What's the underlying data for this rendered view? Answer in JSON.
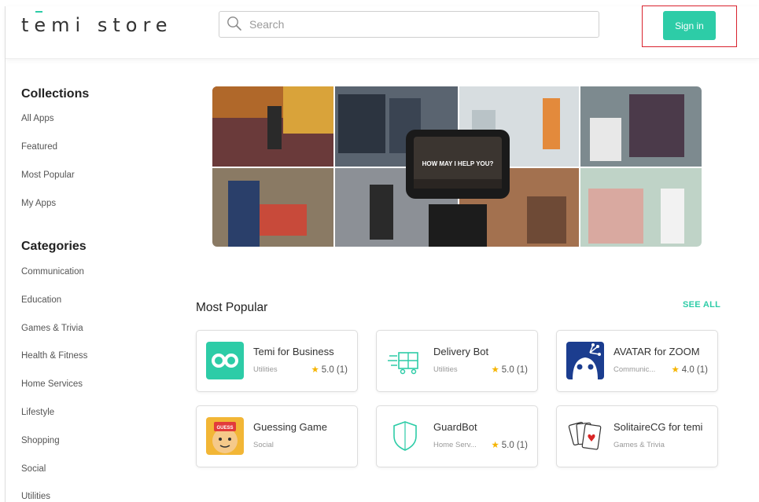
{
  "header": {
    "logo": "temi store",
    "search_placeholder": "Search",
    "sign_in_label": "Sign in"
  },
  "colors": {
    "accent": "#2dcca7",
    "highlight_box": "#d9232e",
    "star": "#f5b400"
  },
  "sidebar": {
    "collections_title": "Collections",
    "collections": [
      "All Apps",
      "Featured",
      "Most Popular",
      "My Apps"
    ],
    "categories_title": "Categories",
    "categories": [
      "Communication",
      "Education",
      "Games & Trivia",
      "Health & Fitness",
      "Home Services",
      "Lifestyle",
      "Shopping",
      "Social",
      "Utilities"
    ]
  },
  "banner": {
    "caption": "HOW MAY I HELP YOU?"
  },
  "most_popular": {
    "title": "Most Popular",
    "see_all": "SEE ALL",
    "apps": [
      {
        "name": "Temi for Business",
        "category": "Utilities",
        "rating": "5.0 (1)",
        "icon": "temi-eyes-icon"
      },
      {
        "name": "Delivery Bot",
        "category": "Utilities",
        "rating": "5.0 (1)",
        "icon": "delivery-cart-icon"
      },
      {
        "name": "AVATAR for ZOOM",
        "category": "Communic...",
        "rating": "4.0 (1)",
        "icon": "avatar-robot-icon"
      },
      {
        "name": "Guessing Game",
        "category": "Social",
        "rating": "",
        "icon": "guess-face-icon"
      },
      {
        "name": "GuardBot",
        "category": "Home Serv...",
        "rating": "5.0 (1)",
        "icon": "shield-icon"
      },
      {
        "name": "SolitaireCG for temi",
        "category": "Games & Trivia",
        "rating": "",
        "icon": "playing-cards-icon"
      }
    ]
  }
}
